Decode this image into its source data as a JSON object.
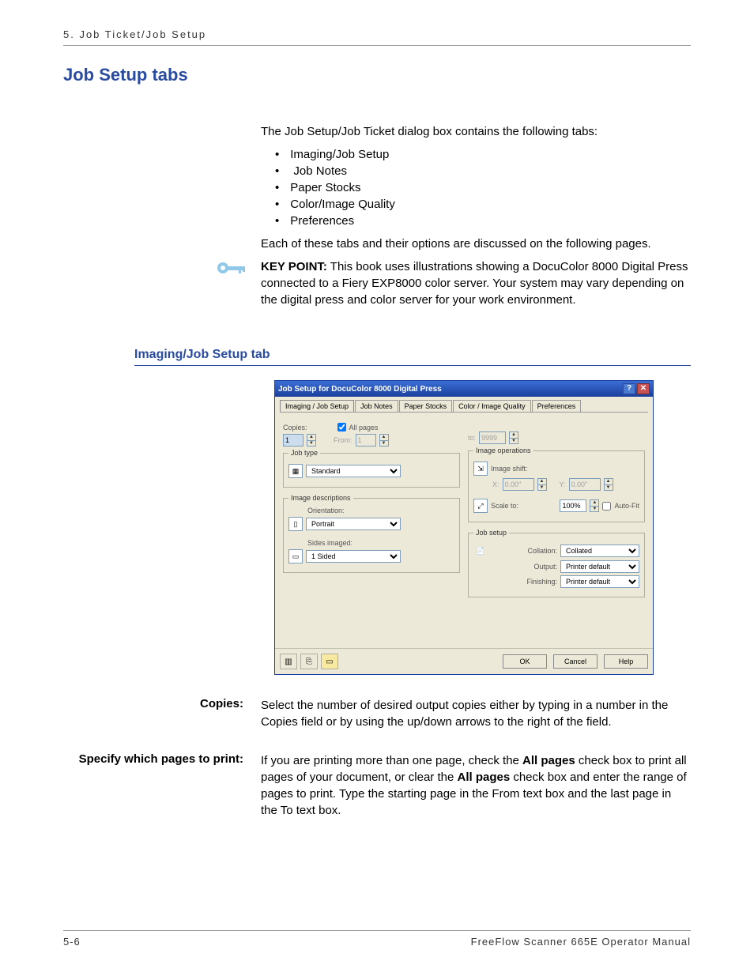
{
  "running_head": "5. Job Ticket/Job Setup",
  "h1": "Job Setup tabs",
  "intro": "The Job Setup/Job Ticket dialog box contains the following tabs:",
  "bullets": [
    "Imaging/Job Setup",
    " Job Notes",
    "Paper Stocks",
    "Color/Image Quality",
    "Preferences"
  ],
  "after_bullets": "Each of these tabs and their options are discussed on the following pages.",
  "keypoint_label": "KEY POINT:",
  "keypoint_body": " This book uses illustrations showing a DocuColor 8000 Digital Press connected to a Fiery EXP8000 color server.  Your system may vary depending on the digital press and color server for your work environment.",
  "h2": "Imaging/Job Setup tab",
  "dialog": {
    "title": "Job Setup for DocuColor 8000 Digital Press",
    "help_glyph": "?",
    "close_glyph": "✕",
    "tabs": [
      "Imaging / Job Setup",
      "Job Notes",
      "Paper Stocks",
      "Color / Image Quality",
      "Preferences"
    ],
    "copies_label": "Copies:",
    "copies_value": "1",
    "allpages_label": "All pages",
    "from_label": "From:",
    "from_value": "1",
    "to_label": "to:",
    "to_value": "9999",
    "jobtype_legend": "Job type",
    "jobtype_value": "Standard",
    "imgdesc_legend": "Image descriptions",
    "orientation_label": "Orientation:",
    "orientation_value": "Portrait",
    "sides_label": "Sides imaged:",
    "sides_value": "1 Sided",
    "imgops_legend": "Image operations",
    "imgshift_label": "Image shift:",
    "x_label": "X:",
    "x_value": "0.00\"",
    "y_label": "Y:",
    "y_value": "0.00\"",
    "scale_label": "Scale to:",
    "scale_value": "100%",
    "autofit_label": "Auto-Fit",
    "jobsetup_legend": "Job setup",
    "collation_label": "Collation:",
    "collation_value": "Collated",
    "output_label": "Output:",
    "output_value": "Printer default",
    "finishing_label": "Finishing:",
    "finishing_value": "Printer default",
    "ok": "OK",
    "cancel": "Cancel",
    "helpbtn": "Help"
  },
  "def1_term": "Copies:",
  "def1_body": "Select the number of desired output copies either by typing in a number in the Copies field or by using the up/down arrows to the right of the field.",
  "def2_term": "Specify which pages to print:",
  "def2_body_a": "If you are printing more than one page, check the ",
  "def2_bold1": "All pages",
  "def2_body_b": " check box to print all pages of your document, or clear the ",
  "def2_bold2": "All pages",
  "def2_body_c": " check box and enter the range of pages to print.  Type the starting page in the From text box and the last page in the To text box.",
  "footer_left": "5-6",
  "footer_right": "FreeFlow Scanner 665E Operator Manual"
}
